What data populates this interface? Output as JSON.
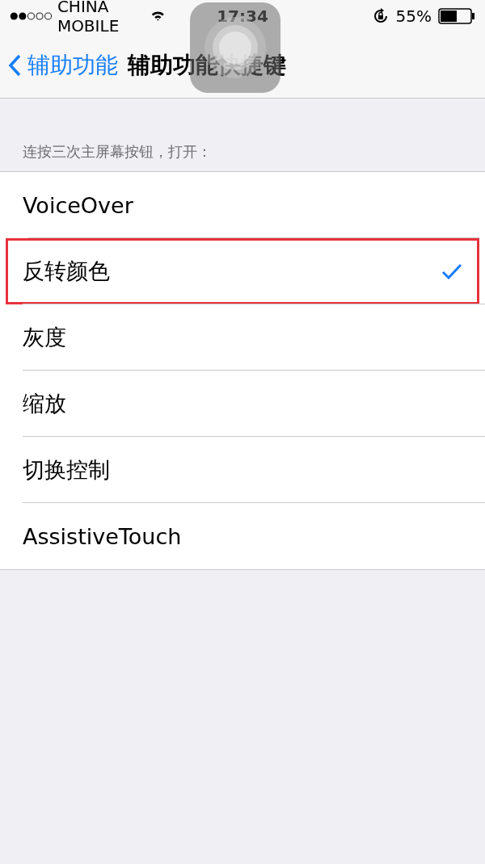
{
  "status_bar": {
    "carrier": "CHINA MOBILE",
    "time": "17:34",
    "battery": "55%"
  },
  "nav_bar": {
    "back_label": "辅助功能",
    "title": "辅助功能快捷键"
  },
  "section": {
    "header": "连按三次主屏幕按钮，打开：",
    "items": [
      {
        "label": "VoiceOver",
        "selected": false,
        "highlighted": false
      },
      {
        "label": "反转颜色",
        "selected": true,
        "highlighted": true
      },
      {
        "label": "灰度",
        "selected": false,
        "highlighted": false
      },
      {
        "label": "缩放",
        "selected": false,
        "highlighted": false
      },
      {
        "label": "切换控制",
        "selected": false,
        "highlighted": false
      },
      {
        "label": "AssistiveTouch",
        "selected": false,
        "highlighted": false
      }
    ]
  }
}
